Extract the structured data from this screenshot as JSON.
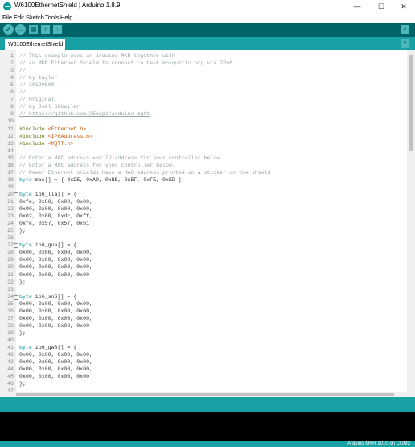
{
  "window": {
    "title": "W6100EthernetShield | Arduino 1.8.9",
    "minimize_glyph": "—",
    "maximize_glyph": "☐",
    "close_glyph": "✕"
  },
  "menu": [
    "File",
    "Edit",
    "Sketch",
    "Tools",
    "Help"
  ],
  "toolbar": {
    "verify_glyph": "✓",
    "upload_glyph": "→",
    "new_glyph": "▤",
    "open_glyph": "↑",
    "save_glyph": "↓",
    "serial_monitor_glyph": "⌕"
  },
  "tabs": [
    {
      "label": "W6100EthernetShield"
    }
  ],
  "tab_menu_glyph": "▼",
  "colors": {
    "toolbar": "#006468",
    "accent": "#17a1a5",
    "comment": "#95a5a6",
    "keyword": "#5e6d03",
    "type": "#00979c",
    "string": "#d35400"
  },
  "editor": {
    "lines": [
      {
        "n": "1",
        "code": "// This example uses an Arduino MKR together with",
        "style": "comment"
      },
      {
        "n": "2",
        "code": "// an MKR Ethernet Shield to connect to test.mosquitto.org via IPv6",
        "style": "comment"
      },
      {
        "n": "3",
        "code": "//",
        "style": "comment"
      },
      {
        "n": "4",
        "code": "// by taylor",
        "style": "comment"
      },
      {
        "n": "5",
        "code": "// 20190509",
        "style": "comment"
      },
      {
        "n": "6",
        "code": "//",
        "style": "comment"
      },
      {
        "n": "7",
        "code": "// Original",
        "style": "comment"
      },
      {
        "n": "8",
        "code": "// by Joël Gähwiler",
        "style": "comment"
      },
      {
        "n": "9",
        "code": "// https://github.com/256dpi/arduino-mqtt",
        "style": "link"
      },
      {
        "n": "10",
        "code": "",
        "style": "plain"
      },
      {
        "n": "11",
        "code": "#include <Ethernet.h>",
        "style": "include",
        "kw": "#include",
        "rest": " ",
        "str": "<Ethernet.h>"
      },
      {
        "n": "12",
        "code": "#include <IP6Address.h>",
        "style": "include",
        "kw": "#include",
        "rest": " ",
        "str": "<IP6Address.h>"
      },
      {
        "n": "13",
        "code": "#include <MQTT.h>",
        "style": "include",
        "kw": "#include",
        "rest": " ",
        "str": "<MQTT.h>"
      },
      {
        "n": "14",
        "code": "",
        "style": "plain"
      },
      {
        "n": "15",
        "code": "// Enter a MAC address and IP address for your controller below.",
        "style": "comment"
      },
      {
        "n": "16",
        "code": "// Enter a MAC address for your controller below.",
        "style": "comment"
      },
      {
        "n": "17",
        "code": "// Newer Ethernet shields have a MAC address printed on a sticker on the shield",
        "style": "comment"
      },
      {
        "n": "18",
        "code": "byte mac[] = { 0xDE, 0xAD, 0xBE, 0xEF, 0xFE, 0xED };",
        "style": "typed",
        "kw": "byte",
        "rest": " mac[] = { 0xDE, 0xAD, 0xBE, 0xEF, 0xFE, 0xED };"
      },
      {
        "n": "19",
        "code": "",
        "style": "plain"
      },
      {
        "n": "20",
        "code": "byte ip6_lla[] = {",
        "style": "typed",
        "kw": "byte",
        "rest": " ip6_lla[] = {",
        "fold": true
      },
      {
        "n": "21",
        "code": "0xfe, 0x80, 0x00, 0x00,",
        "style": "plain"
      },
      {
        "n": "22",
        "code": "0x00, 0x00, 0x00, 0x00,",
        "style": "plain"
      },
      {
        "n": "23",
        "code": "0x02, 0x00, 0xdc, 0xff,",
        "style": "plain"
      },
      {
        "n": "24",
        "code": "0xfe, 0x57, 0x57, 0x61",
        "style": "plain"
      },
      {
        "n": "25",
        "code": "};",
        "style": "plain"
      },
      {
        "n": "26",
        "code": "",
        "style": "plain"
      },
      {
        "n": "27",
        "code": "byte ip6_gua[] = {",
        "style": "typed",
        "kw": "byte",
        "rest": " ip6_gua[] = {",
        "fold": true
      },
      {
        "n": "28",
        "code": "0x00, 0x00, 0x00, 0x00,",
        "style": "plain"
      },
      {
        "n": "29",
        "code": "0x00, 0x00, 0x00, 0x00,",
        "style": "plain"
      },
      {
        "n": "30",
        "code": "0x00, 0x00, 0x00, 0x00,",
        "style": "plain"
      },
      {
        "n": "31",
        "code": "0x00, 0x00, 0x00, 0x00",
        "style": "plain"
      },
      {
        "n": "32",
        "code": "};",
        "style": "plain"
      },
      {
        "n": "33",
        "code": "",
        "style": "plain"
      },
      {
        "n": "34",
        "code": "byte ip6_sn6[] = {",
        "style": "typed",
        "kw": "byte",
        "rest": " ip6_sn6[] = {",
        "fold": true
      },
      {
        "n": "35",
        "code": "0x00, 0x00, 0x00, 0x00,",
        "style": "plain"
      },
      {
        "n": "36",
        "code": "0x00, 0x00, 0x00, 0x00,",
        "style": "plain"
      },
      {
        "n": "37",
        "code": "0x00, 0x00, 0x00, 0x00,",
        "style": "plain"
      },
      {
        "n": "38",
        "code": "0x00, 0x00, 0x00, 0x00",
        "style": "plain"
      },
      {
        "n": "39",
        "code": "};",
        "style": "plain"
      },
      {
        "n": "40",
        "code": "",
        "style": "plain"
      },
      {
        "n": "41",
        "code": "byte ip6_gw6[] = {",
        "style": "typed",
        "kw": "byte",
        "rest": " ip6_gw6[] = {",
        "fold": true
      },
      {
        "n": "42",
        "code": "0x00, 0x00, 0x00, 0x00,",
        "style": "plain"
      },
      {
        "n": "43",
        "code": "0x00, 0x00, 0x00, 0x00,",
        "style": "plain"
      },
      {
        "n": "44",
        "code": "0x00, 0x00, 0x00, 0x00,",
        "style": "plain"
      },
      {
        "n": "45",
        "code": "0x00, 0x00, 0x00, 0x00",
        "style": "plain"
      },
      {
        "n": "46",
        "code": "};",
        "style": "plain"
      },
      {
        "n": "47",
        "code": "",
        "style": "plain"
      }
    ]
  },
  "footer": {
    "board": "Arduino MKR 1010 on COM3"
  }
}
